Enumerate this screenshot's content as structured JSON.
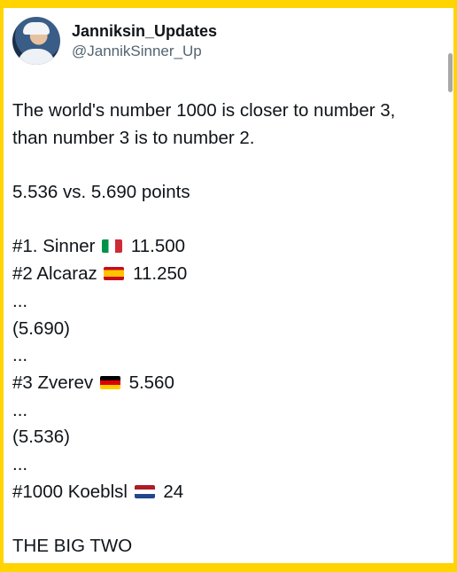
{
  "colors": {
    "frame": "#ffd400",
    "text": "#0f1419",
    "handle": "#536471"
  },
  "author": {
    "display_name": "Janniksin_Updates",
    "handle": "@JannikSinner_Up"
  },
  "tweet": {
    "line1": "The world's number 1000 is closer to number 3,",
    "line2": "than number 3 is to number 2.",
    "points_compare": "5.536 vs. 5.690 points",
    "rank1": {
      "label": "#1. Sinner",
      "flag": "flag-italy",
      "points": "11.500"
    },
    "rank2": {
      "label": "#2 Alcaraz",
      "flag": "flag-spain",
      "points": "11.250"
    },
    "ellipsis": "...",
    "gap1": "(5.690)",
    "rank3": {
      "label": "#3 Zverev",
      "flag": "flag-germany",
      "points": "5.560"
    },
    "gap2": "(5.536)",
    "rank1000": {
      "label": "#1000 Koeblsl",
      "flag": "flag-netherlands",
      "points": "24"
    },
    "closing": "THE BIG TWO"
  }
}
